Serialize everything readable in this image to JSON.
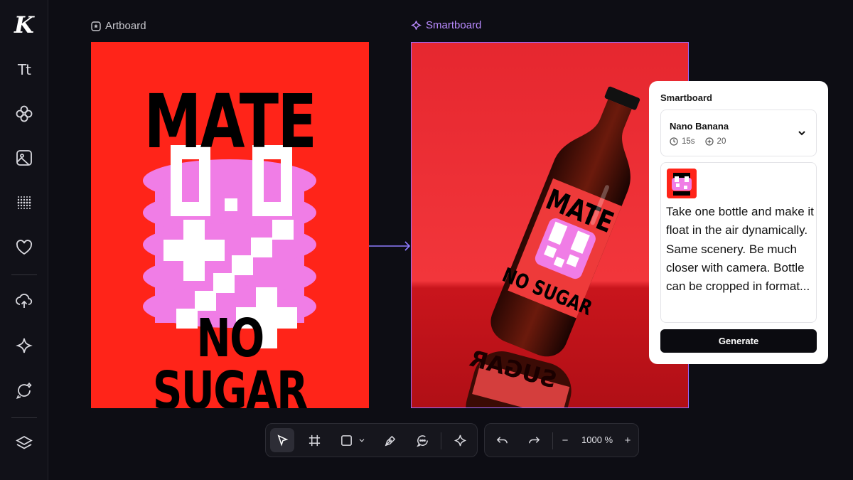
{
  "sidebar": {
    "logo": "K",
    "text_tool_label": "Tt",
    "items": [
      "logo-icon",
      "text-icon",
      "components-icon",
      "image-icon",
      "pattern-icon",
      "favorites-icon",
      "upload-icon",
      "sparkle-icon",
      "chat-ai-icon",
      "layers-icon"
    ]
  },
  "canvas": {
    "artboard_label": "Artboard",
    "smartboard_label": "Smartboard",
    "poster": {
      "title": "MATE",
      "subtitle": "NO SUGAR"
    },
    "bottle_label": {
      "title": "MATE",
      "subtitle": "NO SUGAR"
    },
    "reflection_text": "SUGAR",
    "colors": {
      "poster_bg": "#ff2419",
      "pink": "#f07de6",
      "accent": "#b98bff"
    }
  },
  "panel": {
    "title": "Smartboard",
    "model": {
      "name": "Nano Banana",
      "duration": "15s",
      "credits": "20"
    },
    "prompt": "Take one bottle and make it float in the air dynamically. Same scenery. Be much closer with camera. Bottle can be cropped in format...",
    "generate_label": "Generate"
  },
  "toolbar": {
    "tools": [
      "select-tool",
      "frame-tool",
      "shape-tool",
      "pen-tool",
      "comment-tool",
      "ai-tool"
    ],
    "zoom": "1000 %",
    "zoom_out": "−",
    "zoom_in": "+"
  }
}
